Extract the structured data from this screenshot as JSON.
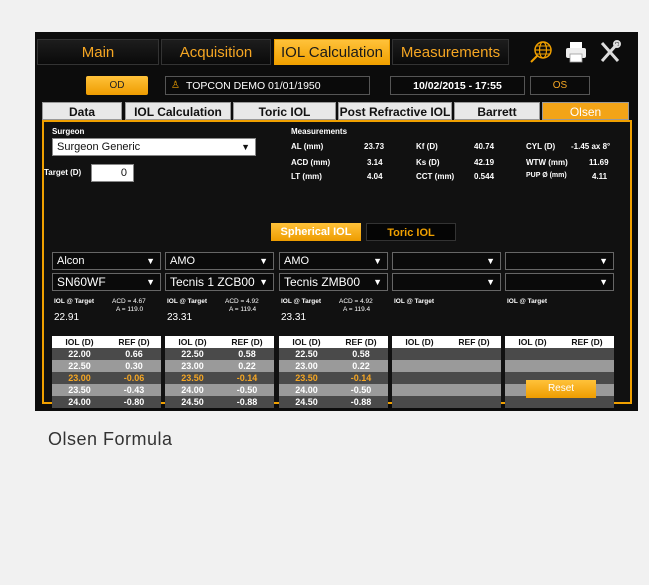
{
  "nav": {
    "tabs": [
      "Main",
      "Acquisition",
      "IOL Calculation",
      "Measurements"
    ]
  },
  "patient": {
    "od_label": "OD",
    "name": "TOPCON DEMO 01/01/1950",
    "datetime": "10/02/2015 - 17:55",
    "os_label": "OS"
  },
  "subtabs": [
    "Data",
    "IOL Calculation",
    "Toric IOL Calculation",
    "Post Refractive IOL",
    "Barrett",
    "Olsen"
  ],
  "surgeon": {
    "label": "Surgeon",
    "value": "Surgeon Generic",
    "target_label": "Target (D)",
    "target_value": "0"
  },
  "measurements": {
    "title": "Measurements",
    "al_label": "AL (mm)",
    "al": "23.73",
    "acd_label": "ACD (mm)",
    "acd": "3.14",
    "lt_label": "LT (mm)",
    "lt": "4.04",
    "kf_label": "Kf (D)",
    "kf": "40.74",
    "ks_label": "Ks (D)",
    "ks": "42.19",
    "cct_label": "CCT (mm)",
    "cct": "0.544",
    "cyl_label": "CYL (D)",
    "cyl": "-1.45 ax 8°",
    "wtw_label": "WTW (mm)",
    "wtw": "11.69",
    "pup_label": "PUP Ø (mm)",
    "pup": "4.11"
  },
  "mode": {
    "spherical": "Spherical IOL",
    "toric": "Toric IOL"
  },
  "table_header": {
    "iol": "IOL (D)",
    "ref": "REF (D)"
  },
  "iol_at_target_label": "IOL @ Target",
  "columns": [
    {
      "manufacturer": "Alcon",
      "model": "SN60WF",
      "acd": "ACD = 4.67",
      "a": "A = 119.0",
      "target": "22.91",
      "rows": [
        [
          "22.00",
          "0.66"
        ],
        [
          "22.50",
          "0.30"
        ],
        [
          "23.00",
          "-0.06"
        ],
        [
          "23.50",
          "-0.43"
        ],
        [
          "24.00",
          "-0.80"
        ]
      ]
    },
    {
      "manufacturer": "AMO",
      "model": "Tecnis 1 ZCB00",
      "acd": "ACD = 4.92",
      "a": "A = 119.4",
      "target": "23.31",
      "rows": [
        [
          "22.50",
          "0.58"
        ],
        [
          "23.00",
          "0.22"
        ],
        [
          "23.50",
          "-0.14"
        ],
        [
          "24.00",
          "-0.50"
        ],
        [
          "24.50",
          "-0.88"
        ]
      ]
    },
    {
      "manufacturer": "AMO",
      "model": "Tecnis ZMB00",
      "acd": "ACD = 4.92",
      "a": "A = 119.4",
      "target": "23.31",
      "rows": [
        [
          "22.50",
          "0.58"
        ],
        [
          "23.00",
          "0.22"
        ],
        [
          "23.50",
          "-0.14"
        ],
        [
          "24.00",
          "-0.50"
        ],
        [
          "24.50",
          "-0.88"
        ]
      ]
    },
    {
      "manufacturer": "",
      "model": "",
      "acd": "",
      "a": "",
      "target": "",
      "rows": [
        [
          "",
          ""
        ],
        [
          "",
          ""
        ],
        [
          "",
          ""
        ],
        [
          "",
          ""
        ],
        [
          "",
          ""
        ]
      ]
    },
    {
      "manufacturer": "",
      "model": "",
      "acd": "",
      "a": "",
      "target": "",
      "rows": [
        [
          "",
          ""
        ],
        [
          "",
          ""
        ],
        [
          "",
          ""
        ],
        [
          "",
          ""
        ],
        [
          "",
          ""
        ]
      ]
    }
  ],
  "reset_label": "Reset",
  "caption": "Olsen Formula",
  "colors": {
    "accent": "#f0a000",
    "highlight": "#f5a623",
    "row_dark": "#4a4a4a",
    "row_light": "#9a9a9a"
  }
}
